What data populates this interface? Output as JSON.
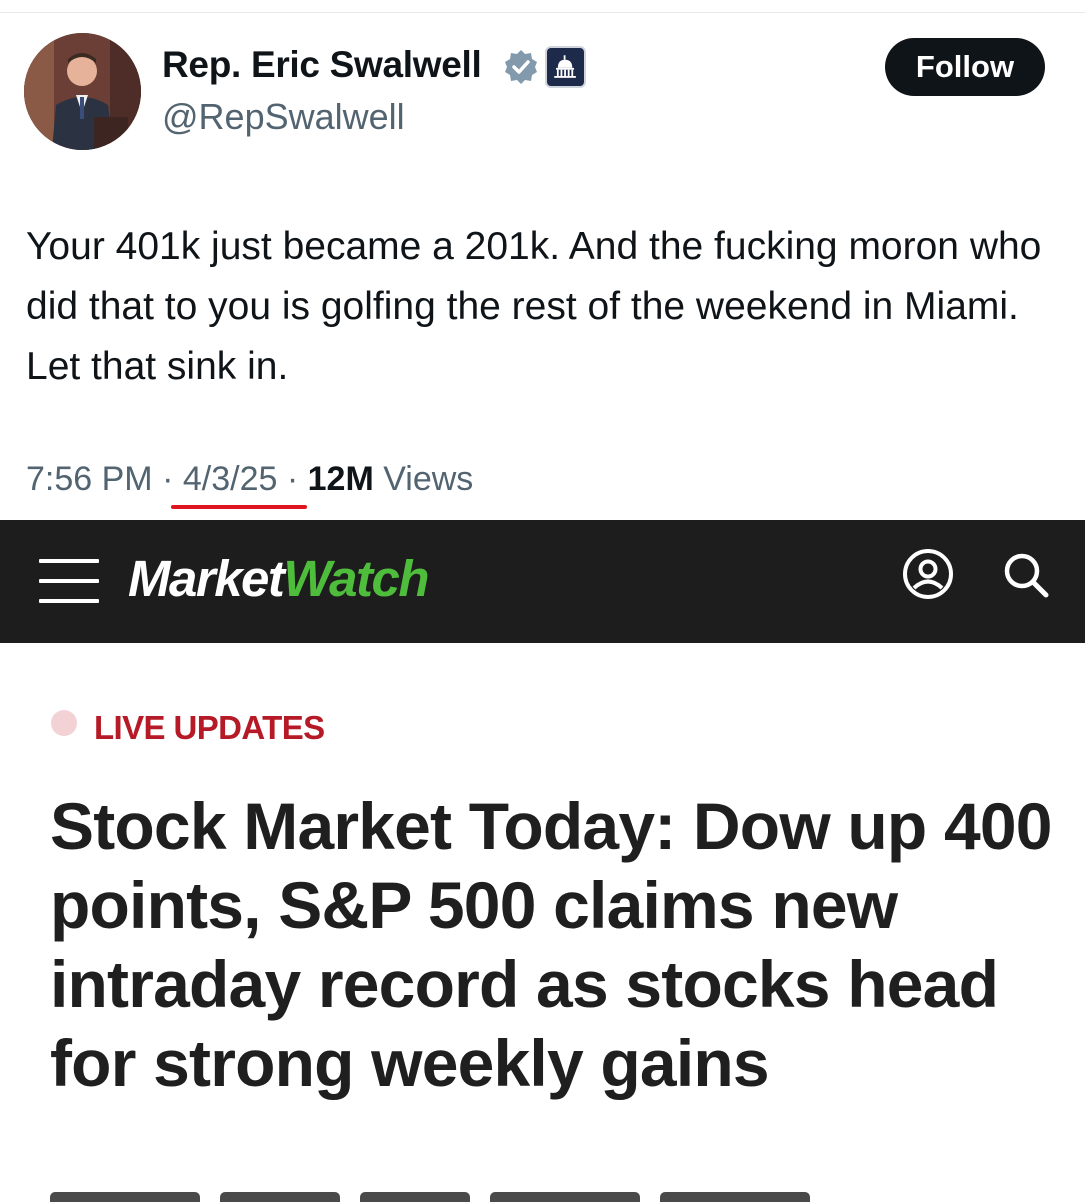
{
  "tweet": {
    "author_name": "Rep. Eric Swalwell",
    "author_handle": "@RepSwalwell",
    "follow_label": "Follow",
    "text": "Your 401k just became a 201k. And the fucking moron who did that to you is golfing the rest of the weekend in Miami. Let that sink in.",
    "time": "7:56 PM",
    "date": "4/3/25",
    "separator": "·",
    "views_count": "12M",
    "views_label": "Views",
    "icons": [
      "avatar",
      "verified-badge-icon",
      "capitol-affiliation-icon"
    ],
    "colors": {
      "date_underline": "#e0141e",
      "follow_button": "#0f1419"
    }
  },
  "marketwatch": {
    "logo_part1": "Market",
    "logo_part2": "Watch",
    "icons": [
      "menu-icon",
      "account-icon",
      "search-icon"
    ],
    "colors": {
      "header_bg": "#1d1d1d",
      "logo_green": "#4fbd3c"
    }
  },
  "article": {
    "live_label": "LIVE UPDATES",
    "headline": "Stock Market Today: Dow up 400 points, S&P 500 claims new intraday record as stocks head for strong weekly gains",
    "colors": {
      "live_label": "#b51a26"
    }
  }
}
